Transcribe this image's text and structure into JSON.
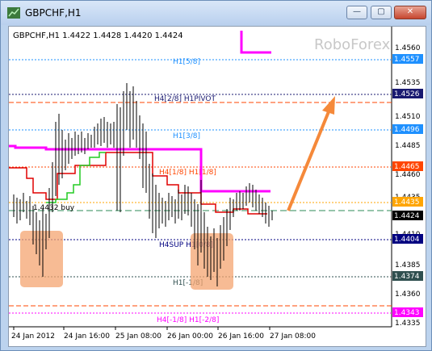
{
  "window": {
    "title": "GBPCHF,H1",
    "buttons": {
      "minimize": "—",
      "maximize": "▢",
      "close": "✕"
    }
  },
  "chart": {
    "info_line": "GBPCHF,H1  1.4422 1.4428 1.4420 1.4424",
    "watermark": "RoboForex",
    "price_axis": {
      "ticks": [
        "1.4560",
        "1.4535",
        "1.4510",
        "1.4485",
        "1.4460",
        "1.4435",
        "1.4410",
        "1.4385",
        "1.4360",
        "1.4335"
      ],
      "markers": [
        {
          "label": "1.4557",
          "color": "#1e90ff"
        },
        {
          "label": "1.4526",
          "color": "#191970"
        },
        {
          "label": "1.4496",
          "color": "#1e90ff"
        },
        {
          "label": "1.4465",
          "color": "#ff4500"
        },
        {
          "label": "1.4435",
          "color": "#ffa500"
        },
        {
          "label": "1.4424",
          "color": "#000000"
        },
        {
          "label": "1.4404",
          "color": "#000080"
        },
        {
          "label": "1.4374",
          "color": "#2f4f4f"
        },
        {
          "label": "1.4343",
          "color": "#ff00ff"
        }
      ]
    },
    "time_axis": [
      "24 Jan 2012",
      "24 Jan 16:00",
      "25 Jan 08:00",
      "26 Jan 00:00",
      "26 Jan 16:00",
      "27 Jan 08:00"
    ],
    "level_labels": {
      "h1_5_8": "H1[5/8]",
      "h4_pivot": "H4[2/8] H1PIVOT",
      "h1_3_8": "H1[3/8]",
      "h4_1_8": "H4[1/8] H1[1/8]",
      "buy": "1.4432 buy",
      "h4sup": "H4SUP H1[0/8]",
      "h1_m1_8": "H1[-1/8]",
      "h4_m1_8": "H4[-1/8] H1[-2/8]"
    },
    "colors": {
      "blue_level": "#1e90ff",
      "pivot": "#191970",
      "orange_red": "#ff4500",
      "orange": "#ffa500",
      "magenta": "#ff00ff",
      "arrow": "#f5893a",
      "highlight": "#f4a470"
    }
  }
}
